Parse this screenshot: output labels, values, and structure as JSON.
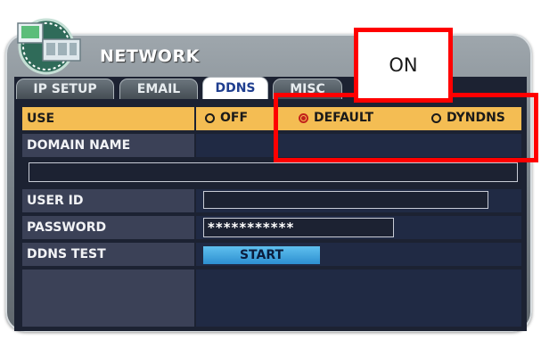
{
  "window": {
    "title": "NETWORK"
  },
  "tabs": [
    {
      "label": "IP SETUP",
      "active": false
    },
    {
      "label": "EMAIL",
      "active": false
    },
    {
      "label": "DDNS",
      "active": true
    },
    {
      "label": "MISC",
      "active": false
    }
  ],
  "rows": {
    "use": {
      "label": "USE",
      "options": [
        {
          "label": "OFF",
          "selected": false
        },
        {
          "label": "DEFAULT",
          "selected": true
        },
        {
          "label": "DYNDNS",
          "selected": false
        }
      ]
    },
    "domain_name": {
      "label": "DOMAIN NAME",
      "value": ""
    },
    "user_id": {
      "label": "USER ID",
      "value": ""
    },
    "password": {
      "label": "PASSWORD",
      "value": "***********"
    },
    "ddns_test": {
      "label": "DDNS TEST",
      "button_label": "START"
    }
  },
  "annotation": {
    "label": "ON",
    "color": "#ff0000"
  },
  "colors": {
    "highlight_row": "#f4bd53",
    "panel_bg": "#1c2232",
    "accent_button": "#2d8fd0"
  }
}
